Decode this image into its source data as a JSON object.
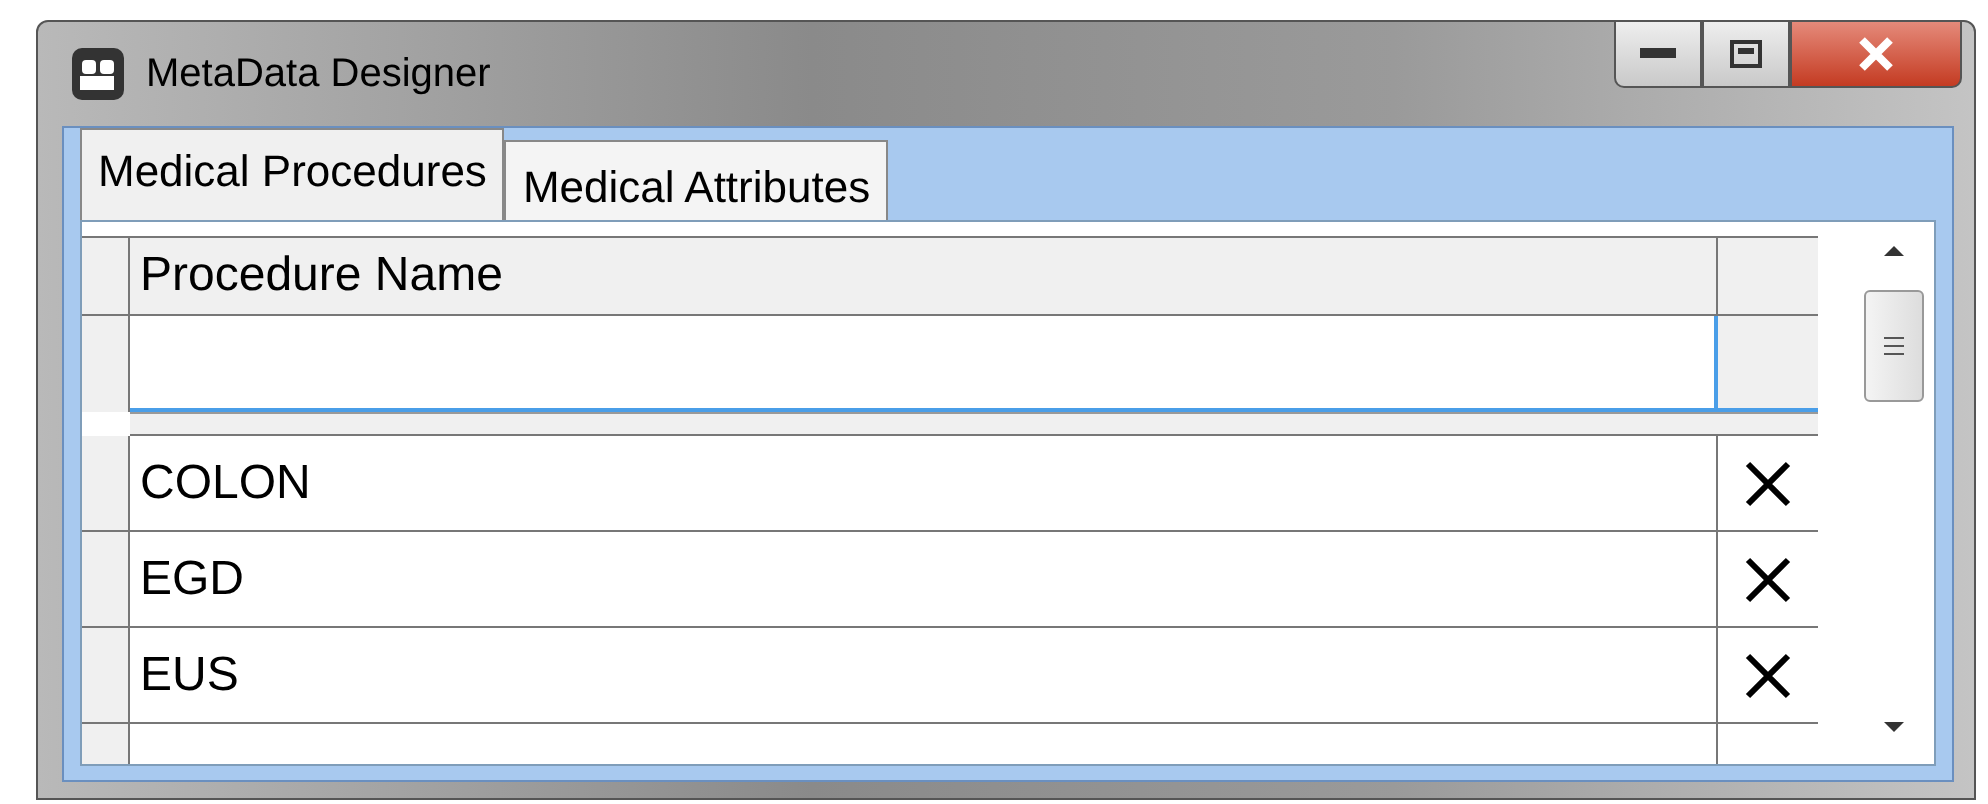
{
  "window": {
    "title": "MetaData Designer"
  },
  "tabs": [
    {
      "label": "Medical Procedures",
      "selected": true
    },
    {
      "label": "Medical Attributes",
      "selected": false
    }
  ],
  "grid": {
    "columns": [
      "Procedure Name"
    ],
    "rows": [
      {
        "name": "COLON"
      },
      {
        "name": "EGD"
      },
      {
        "name": "EUS"
      }
    ]
  }
}
